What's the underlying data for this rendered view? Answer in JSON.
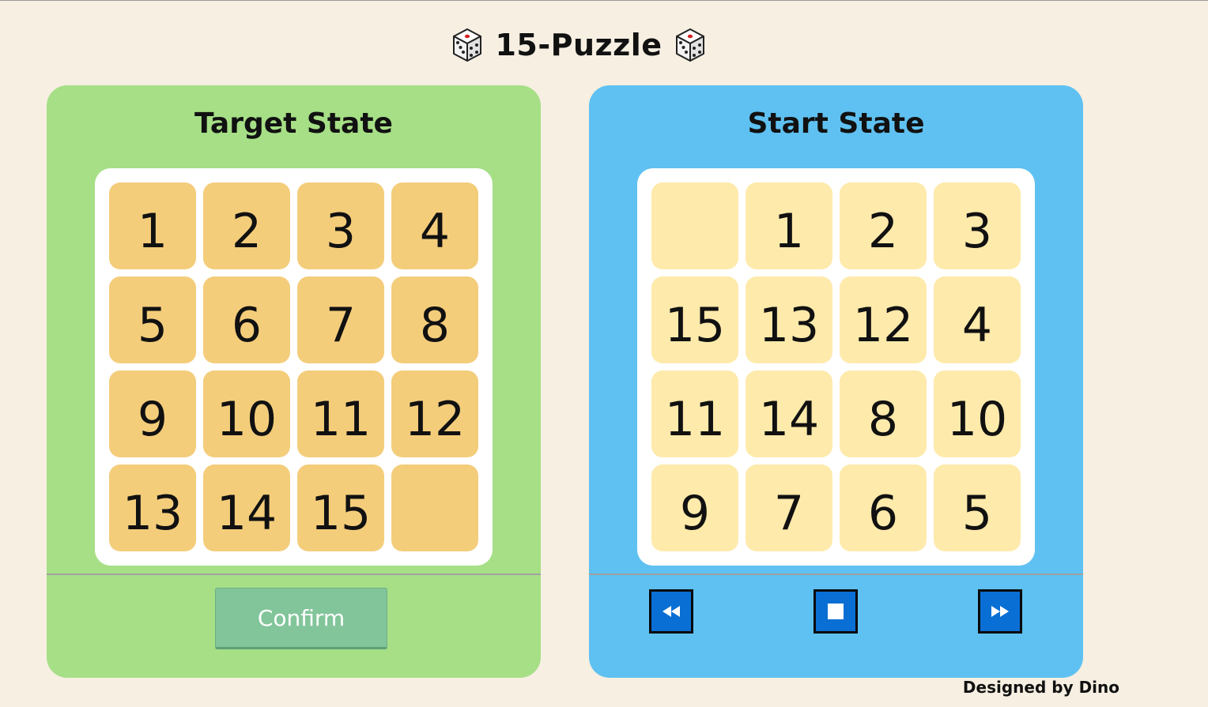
{
  "header": {
    "title": "15-Puzzle",
    "left_icon": "dice-icon",
    "right_icon": "dice-icon"
  },
  "target_panel": {
    "title": "Target State",
    "tiles": [
      "1",
      "2",
      "3",
      "4",
      "5",
      "6",
      "7",
      "8",
      "9",
      "10",
      "11",
      "12",
      "13",
      "14",
      "15",
      ""
    ],
    "confirm_label": "Confirm"
  },
  "start_panel": {
    "title": "Start State",
    "tiles": [
      "",
      "1",
      "2",
      "3",
      "15",
      "13",
      "12",
      "4",
      "11",
      "14",
      "8",
      "10",
      "9",
      "7",
      "6",
      "5"
    ],
    "controls": [
      "rewind-icon",
      "stop-icon",
      "fast-forward-icon"
    ]
  },
  "footer": {
    "credit": "Designed by Dino"
  },
  "colors": {
    "background": "#f6efe2",
    "target_panel": "#a6df86",
    "start_panel": "#5fc1f1",
    "target_tile": "#f4cd7b",
    "start_tile": "#feeaab",
    "confirm_button": "#82c59a",
    "control_button": "#0a6fd4"
  }
}
